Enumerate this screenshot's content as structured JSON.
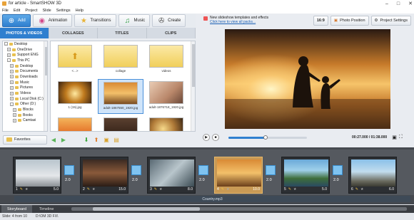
{
  "window": {
    "title": "for article - SmartSHOW 3D",
    "controls": [
      "–",
      "□",
      "✕"
    ]
  },
  "menu": [
    "File",
    "Edit",
    "Project",
    "Slide",
    "Settings",
    "Help"
  ],
  "toolbar": {
    "buttons": [
      {
        "label": "Add",
        "icon": "plus-icon"
      },
      {
        "label": "Animation",
        "icon": "animation-icon"
      },
      {
        "label": "Transitions",
        "icon": "star-icon"
      },
      {
        "label": "Music",
        "icon": "music-icon"
      },
      {
        "label": "Create",
        "icon": "film-reel-icon"
      }
    ]
  },
  "tabs": [
    "PHOTOS & VIDEOS",
    "COLLAGES",
    "TITLES",
    "CLIPS"
  ],
  "tree": [
    {
      "label": "Desktop",
      "level": 0,
      "exp": "-"
    },
    {
      "label": "OneDrive",
      "level": 1,
      "exp": "+"
    },
    {
      "label": "Support ENG",
      "level": 1,
      "exp": "+"
    },
    {
      "label": "This PC",
      "level": 1,
      "exp": "-"
    },
    {
      "label": "Desktop",
      "level": 2,
      "exp": "+"
    },
    {
      "label": "Documents",
      "level": 2,
      "exp": "+"
    },
    {
      "label": "Downloads",
      "level": 2,
      "exp": "+"
    },
    {
      "label": "Music",
      "level": 2,
      "exp": "+"
    },
    {
      "label": "Pictures",
      "level": 2,
      "exp": "+"
    },
    {
      "label": "Videos",
      "level": 2,
      "exp": "+"
    },
    {
      "label": "Local Disk (C:)",
      "level": 2,
      "exp": "+"
    },
    {
      "label": "Other (D:)",
      "level": 2,
      "exp": "-"
    },
    {
      "label": "Blocks",
      "level": 3,
      "exp": "+"
    },
    {
      "label": "Books",
      "level": 3,
      "exp": "+"
    },
    {
      "label": "Camtasi",
      "level": 3,
      "exp": "+"
    }
  ],
  "files": [
    {
      "caption": "<...>",
      "kind": "up-folder"
    },
    {
      "caption": "collage",
      "kind": "folder"
    },
    {
      "caption": "videos",
      "kind": "folder"
    },
    {
      "caption": "1 (15).jpg",
      "kind": "sparkle"
    },
    {
      "caption": "adult-1867550_1920.jpg",
      "kind": "beach",
      "selected": true
    },
    {
      "caption": "adult-1876718_1920.jpg",
      "kind": "portrait"
    },
    {
      "caption": "",
      "kind": "sunset"
    },
    {
      "caption": "",
      "kind": "dark"
    },
    {
      "caption": "",
      "kind": "bokeh"
    }
  ],
  "favorites": {
    "label": "Favorites"
  },
  "promo": {
    "text": "New slideshow templates and effects",
    "link": "Click here to view all packs..."
  },
  "right_buttons": [
    {
      "label": "16:9"
    },
    {
      "label": "Photo Position",
      "icon": "camera-icon"
    },
    {
      "label": "Project Settings",
      "icon": "gear-icon"
    }
  ],
  "player": {
    "timecode": "00:27.000 / 01:38.000",
    "progress": 0.47
  },
  "slides": [
    {
      "num": "1",
      "dur": "5.0",
      "kind": "car"
    },
    {
      "num": "2",
      "dur": "15.0",
      "kind": "car-dark"
    },
    {
      "num": "3",
      "dur": "8.0",
      "kind": "collage"
    },
    {
      "num": "4",
      "dur": "10.0",
      "kind": "beach",
      "selected": true
    },
    {
      "num": "5",
      "dur": "5.0",
      "kind": "coast"
    },
    {
      "num": "6",
      "dur": "6.0",
      "kind": "rocks"
    }
  ],
  "transitions": [
    {
      "dur": "2.0"
    },
    {
      "dur": "2.0"
    },
    {
      "dur": "2.0"
    },
    {
      "dur": "2.0"
    },
    {
      "dur": "2.0"
    }
  ],
  "audio": {
    "track": "Country.mp3"
  },
  "board_tabs": [
    "Storyboard",
    "Timeline"
  ],
  "status": {
    "slide": "Slide: 4 from 10",
    "path": "D:\\OM 3D FX\\"
  }
}
